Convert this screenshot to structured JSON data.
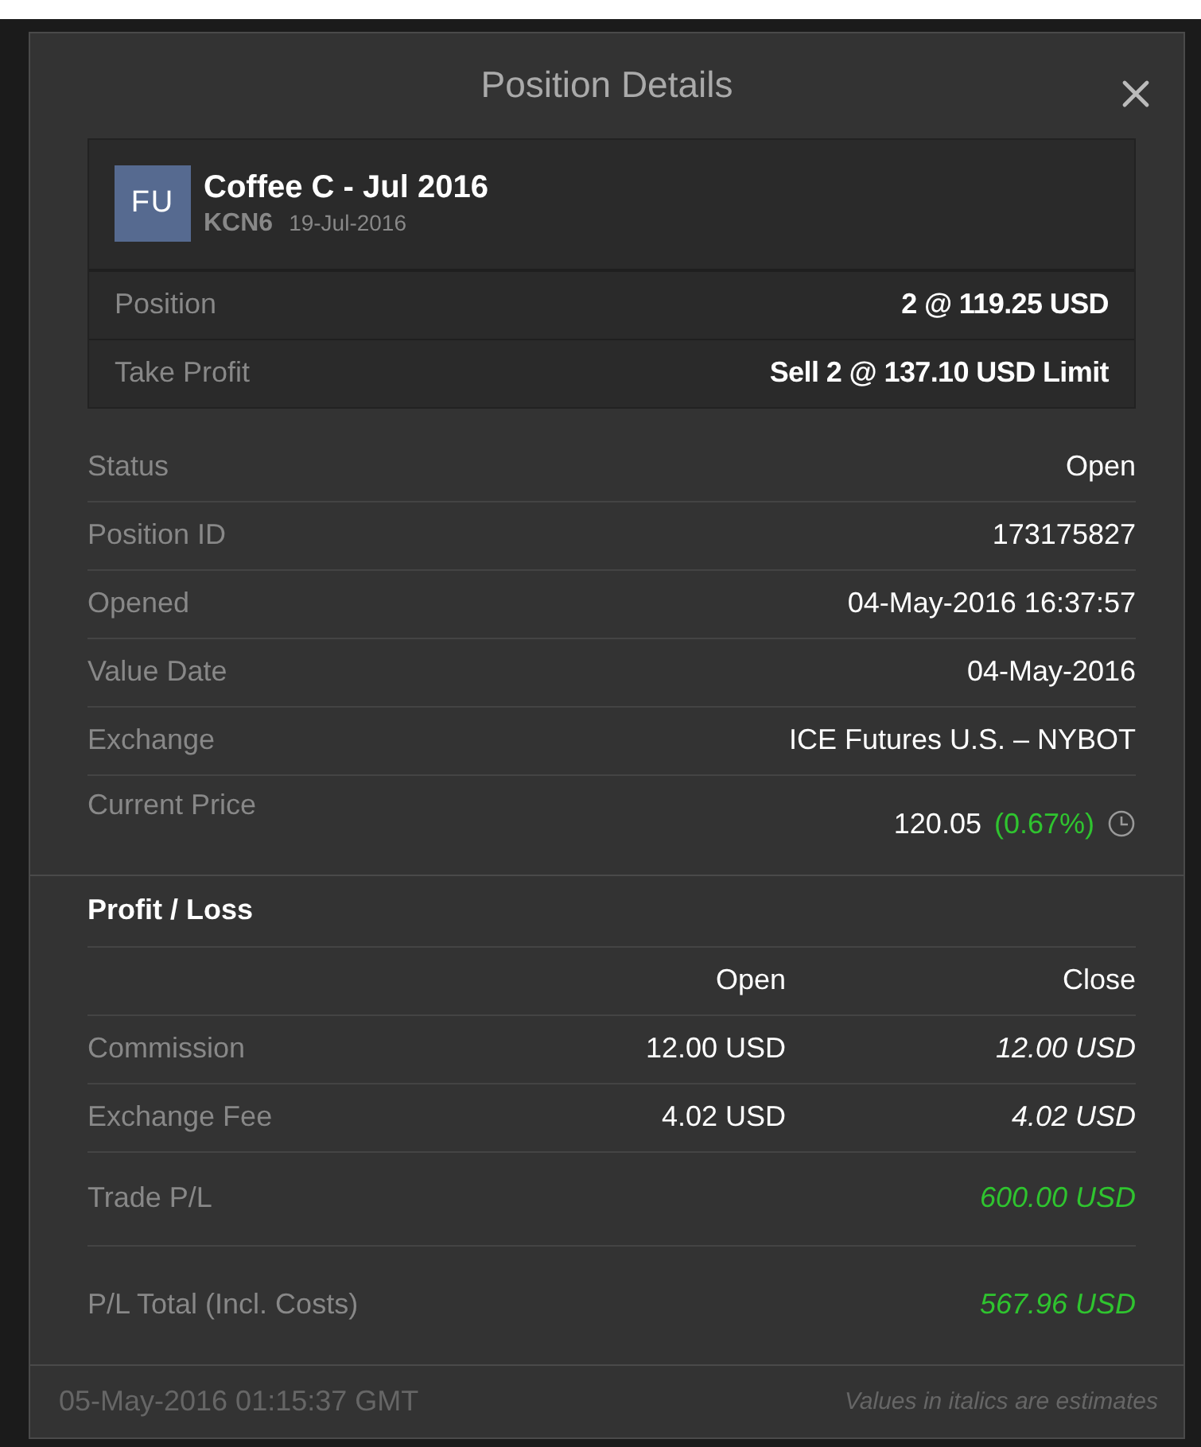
{
  "dialog": {
    "title": "Position Details"
  },
  "instrument": {
    "badge": "FU",
    "name": "Coffee C - Jul 2016",
    "symbol": "KCN6",
    "expiry": "19-Jul-2016",
    "rows": [
      {
        "label": "Position",
        "value": "2 @ 119.25 USD"
      },
      {
        "label": "Take Profit",
        "value": "Sell 2 @ 137.10 USD Limit"
      }
    ]
  },
  "details": [
    {
      "label": "Status",
      "value": "Open"
    },
    {
      "label": "Position ID",
      "value": "173175827"
    },
    {
      "label": "Opened",
      "value": "04-May-2016 16:37:57"
    },
    {
      "label": "Value Date",
      "value": "04-May-2016"
    },
    {
      "label": "Exchange",
      "value": "ICE Futures U.S. – NYBOT"
    }
  ],
  "current_price": {
    "label": "Current Price",
    "value": "120.05",
    "change": "(0.67%)",
    "color": "#2fc42f"
  },
  "profit_loss": {
    "title": "Profit / Loss",
    "columns": [
      "Open",
      "Close"
    ],
    "rows": [
      {
        "label": "Commission",
        "open": "12.00 USD",
        "close": "12.00 USD",
        "close_estimate": true
      },
      {
        "label": "Exchange Fee",
        "open": "4.02 USD",
        "close": "4.02 USD",
        "close_estimate": true
      }
    ],
    "totals": [
      {
        "label": "Trade P/L",
        "value": "600.00 USD",
        "estimate": true,
        "color": "#2fc42f"
      },
      {
        "label": "P/L Total (Incl. Costs)",
        "value": "567.96 USD",
        "estimate": true,
        "color": "#2fc42f"
      }
    ]
  },
  "footer": {
    "timestamp": "05-May-2016 01:15:37 GMT",
    "note": "Values in italics are estimates"
  }
}
